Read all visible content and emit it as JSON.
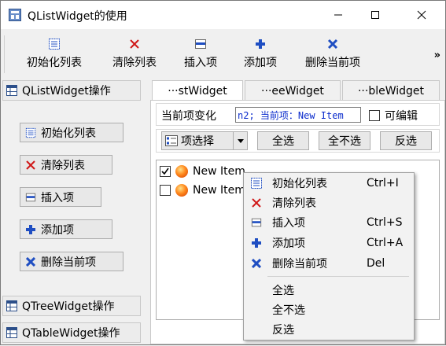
{
  "window": {
    "title": "QListWidget的使用"
  },
  "toolbar": {
    "items": [
      {
        "label": "初始化列表",
        "icon": "init-list-icon"
      },
      {
        "label": "清除列表",
        "icon": "clear-x-icon"
      },
      {
        "label": "插入项",
        "icon": "insert-item-icon"
      },
      {
        "label": "添加项",
        "icon": "add-plus-icon"
      },
      {
        "label": "删除当前项",
        "icon": "delete-x-icon"
      }
    ],
    "overflow": "»"
  },
  "sections": {
    "list": "QListWidget操作",
    "tree": "QTreeWidget操作",
    "table": "QTableWidget操作"
  },
  "left_buttons": [
    {
      "label": "初始化列表"
    },
    {
      "label": "清除列表"
    },
    {
      "label": "插入项"
    },
    {
      "label": "添加项"
    },
    {
      "label": "删除当前项"
    }
  ],
  "tabs": [
    "···stWidget",
    "···eeWidget",
    "···bleWidget"
  ],
  "current": {
    "label": "当前项变化",
    "value": "n2; 当前项：New Item",
    "editable_label": "可编辑"
  },
  "selection": {
    "dropdown": "项选择",
    "select_all": "全选",
    "select_none": "全不选",
    "invert": "反选"
  },
  "list_items": [
    {
      "text": "New Item",
      "checked": true
    },
    {
      "text": "New Item",
      "checked": false
    }
  ],
  "context_menu": {
    "items": [
      {
        "label": "初始化列表",
        "shortcut": "Ctrl+I"
      },
      {
        "label": "清除列表",
        "shortcut": ""
      },
      {
        "label": "插入项",
        "shortcut": "Ctrl+S"
      },
      {
        "label": "添加项",
        "shortcut": "Ctrl+A"
      },
      {
        "label": "删除当前项",
        "shortcut": "Del"
      },
      {
        "label": "全选",
        "shortcut": ""
      },
      {
        "label": "全不选",
        "shortcut": ""
      },
      {
        "label": "反选",
        "shortcut": ""
      }
    ]
  },
  "colors": {
    "accent_blue": "#1f4ec2",
    "red": "#d01818",
    "field_text": "#0a2bcc"
  }
}
